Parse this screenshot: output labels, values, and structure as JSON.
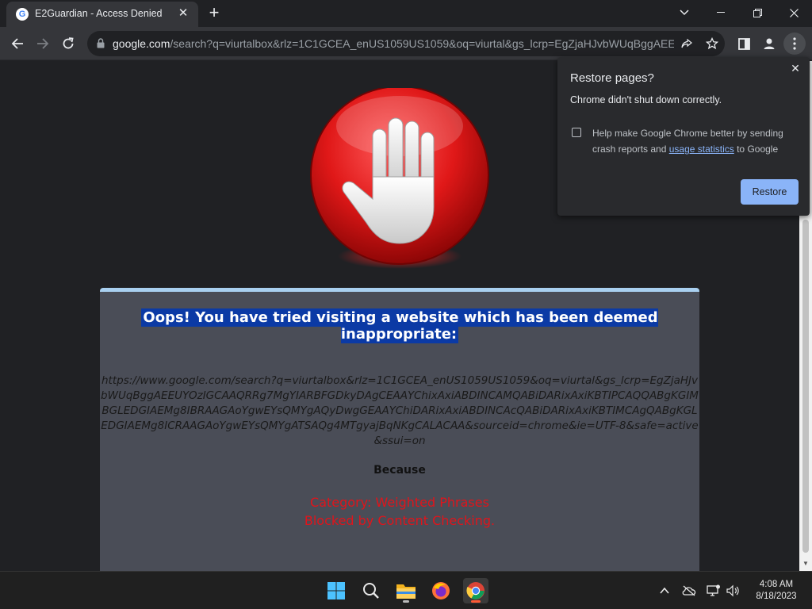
{
  "tab": {
    "title": "E2Guardian - Access Denied",
    "favicon_letter": "G"
  },
  "window_controls": [
    "chevron-down-icon",
    "minimize-icon",
    "restore-icon",
    "close-icon"
  ],
  "omnibox": {
    "host": "google.com",
    "path": "/search?q=viurtalbox&rlz=1C1GCEA_enUS1059US1059&oq=viurtal&gs_lcrp=EgZjaHJvbWUqBggAEE..."
  },
  "page": {
    "headline": "Oops! You have tried visiting a website which has been deemed inappropriate:",
    "blocked_url": "https://www.google.com/search?q=viurtalbox&rlz=1C1GCEA_enUS1059US1059&oq=viurtal&gs_lcrp=EgZjaHJvbWUqBggAEEUYOzIGCAAQRRg7MgYIARBFGDkyDAgCEAAYChixAxiABDINCAMQABiDARixAxiKBTIPCAQQABgKGIMBGLEDGIAEMg8IBRAAGAoYgwEYsQMYgAQyDwgGEAAYChiDARixAxiABDINCAcQABiDARixAxiKBTIMCAgQABgKGLEDGIAEMg8ICRAAGAoYgwEYsQMYgATSAQg4MTgyajBqNKgCALACAA&sourceid=chrome&ie=UTF-8&safe=active&ssui=on",
    "because": "Because",
    "reason_line1": "Category: Weighted Phrases",
    "reason_line2": "Blocked by Content Checking."
  },
  "popup": {
    "title": "Restore pages?",
    "message": "Chrome didn't shut down correctly.",
    "help_prefix": "Help make Google Chrome better by sending crash reports and ",
    "help_link": "usage statistics",
    "help_suffix": " to Google",
    "button": "Restore"
  },
  "taskbar": {
    "apps": [
      "windows-start-icon",
      "search-icon",
      "file-explorer-icon",
      "firefox-icon",
      "chrome-icon"
    ],
    "time": "4:08 AM",
    "date": "8/18/2023"
  },
  "colors": {
    "headline_bg": "#0b3aa5",
    "reason_red": "#e0141b",
    "panel_bg": "#4a4d57",
    "accent_blue": "#8ab4f8"
  }
}
